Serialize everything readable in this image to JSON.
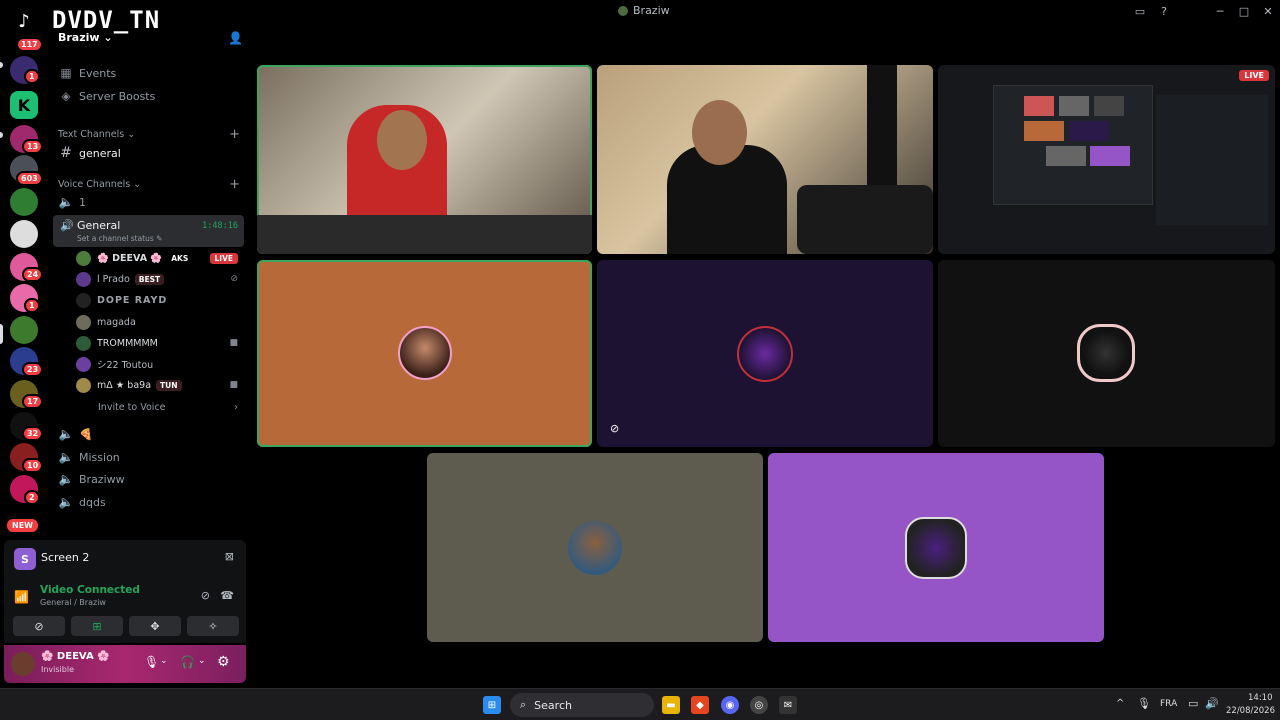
{
  "window": {
    "title": "Braziw"
  },
  "brand": {
    "name": "DVDV_TN",
    "guild": "Braziw ⌄"
  },
  "rail": {
    "badges": [
      "117",
      "1",
      "13",
      "603",
      "24",
      "1",
      "23",
      "17",
      "32",
      "10",
      "2"
    ],
    "new_label": "NEW"
  },
  "channels": {
    "events": "Events",
    "boosts": "Server Boosts",
    "text_category": "Text Channels ⌄",
    "general_text": "general",
    "voice_category": "Voice Channels ⌄",
    "voice_1": "1",
    "voice_general": "General",
    "voice_general_time": "1:48:16",
    "voice_general_status": "Set a channel status ✎",
    "members": [
      {
        "name": "🌸 DEEVA 🌸",
        "tag": "AKS",
        "extra": "LIVE"
      },
      {
        "name": "l Prado",
        "tag": "BEST",
        "extra": ""
      },
      {
        "name": "DOPE RAYD",
        "tag": "",
        "extra": ""
      },
      {
        "name": "magada",
        "tag": "",
        "extra": ""
      },
      {
        "name": "TROMMMMM",
        "tag": "",
        "extra": "cam"
      },
      {
        "name": "シ22 Toutou",
        "tag": "",
        "extra": ""
      },
      {
        "name": "mΔ ★ ba9a",
        "tag": "TUN",
        "extra": "cam"
      }
    ],
    "invite": "Invite to Voice",
    "voice_pizza": "🍕",
    "voice_mission": "Mission",
    "voice_braziww": "Braziww",
    "voice_dqds": "dqds"
  },
  "screen_panel": {
    "label": "Screen 2"
  },
  "voice_panel": {
    "status": "Video Connected",
    "location": "General / Braziw"
  },
  "user_panel": {
    "name": "🌸 DEEVA 🌸",
    "status": "Invisible"
  },
  "stream": {
    "live_label": "LIVE"
  },
  "taskbar": {
    "search": "Search",
    "lang": "FRA",
    "time": "14:10",
    "date": "22/08/2026"
  },
  "colors": {
    "accent_green": "#23a55a",
    "live_red": "#da373c",
    "orange_tile": "#b8693a",
    "purple_tile": "#9655c6",
    "gray_tile": "#5e5b4f",
    "dark_purple_tile": "#1e1232"
  }
}
